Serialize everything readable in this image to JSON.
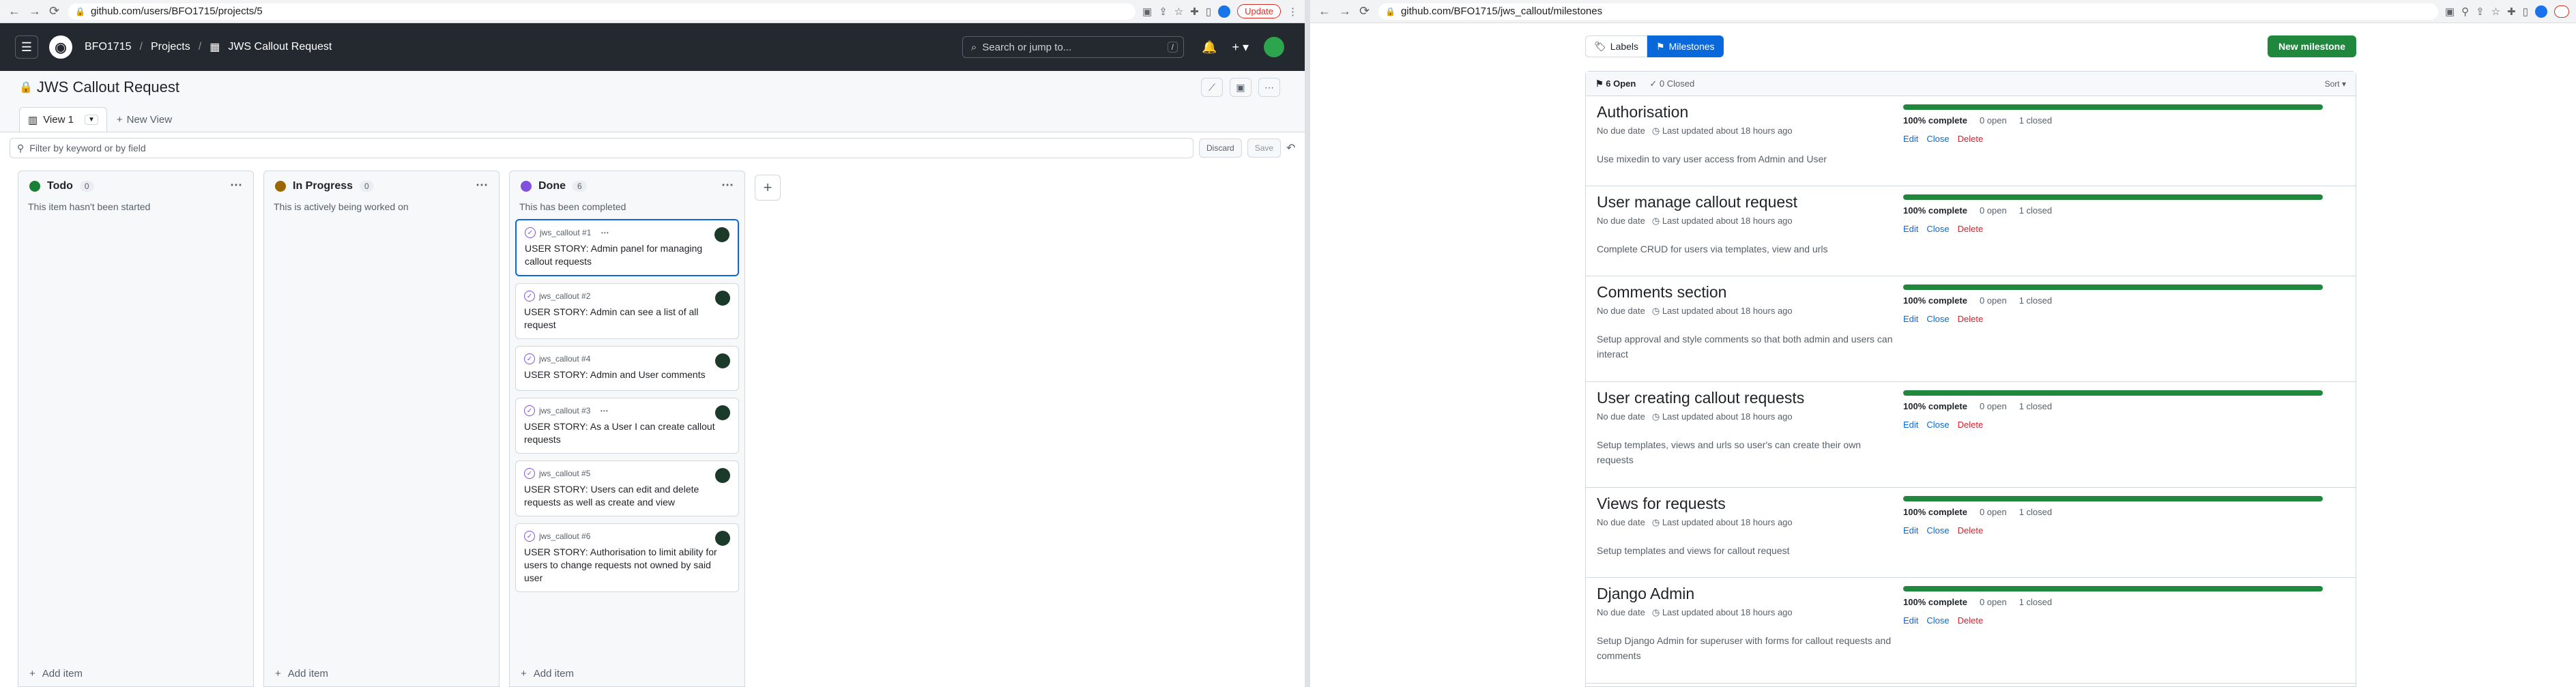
{
  "left": {
    "browser": {
      "url": "github.com/users/BFO1715/projects/5",
      "update_label": "Update"
    },
    "header": {
      "user": "BFO1715",
      "projects": "Projects",
      "project_name": "JWS Callout Request",
      "search_placeholder": "Search or jump to..."
    },
    "project_title": "JWS Callout Request",
    "views": {
      "active": "View 1",
      "new_view": "New View"
    },
    "filter": {
      "placeholder": "Filter by keyword or by field",
      "discard": "Discard",
      "save": "Save"
    },
    "columns": [
      {
        "name": "Todo",
        "count": "0",
        "color": "#1a7f37",
        "desc": "This item hasn't been started",
        "add": "Add item",
        "cards": []
      },
      {
        "name": "In Progress",
        "count": "0",
        "color": "#9a6700",
        "desc": "This is actively being worked on",
        "add": "Add item",
        "cards": []
      },
      {
        "name": "Done",
        "count": "6",
        "color": "#8250df",
        "desc": "This has been completed",
        "add": "Add item",
        "cards": [
          {
            "ref": "jws_callout #1",
            "title": "USER STORY: Admin panel for managing callout requests",
            "selected": true,
            "dots": true
          },
          {
            "ref": "jws_callout #2",
            "title": "USER STORY: Admin can see a list of all request",
            "selected": false,
            "dots": false
          },
          {
            "ref": "jws_callout #4",
            "title": "USER STORY: Admin and User comments",
            "selected": false,
            "dots": false
          },
          {
            "ref": "jws_callout #3",
            "title": "USER STORY: As a User I can create callout requests",
            "selected": false,
            "dots": true
          },
          {
            "ref": "jws_callout #5",
            "title": "USER STORY: Users can edit and delete requests as well as create and view",
            "selected": false,
            "dots": false
          },
          {
            "ref": "jws_callout #6",
            "title": "USER STORY: Authorisation to limit ability for users to change requests not owned by said user",
            "selected": false,
            "dots": false
          }
        ]
      }
    ]
  },
  "right": {
    "browser": {
      "url": "github.com/BFO1715/jws_callout/milestones"
    },
    "tabs": {
      "labels": "Labels",
      "milestones": "Milestones"
    },
    "new_milestone": "New milestone",
    "summary": {
      "open": "6 Open",
      "closed": "0 Closed",
      "sort": "Sort"
    },
    "milestones": [
      {
        "title": "Authorisation",
        "due": "No due date",
        "updated": "Last updated about 18 hours ago",
        "desc": "Use mixedin to vary user access from Admin and User",
        "progress": 1.0,
        "complete": "100% complete",
        "open": "0 open",
        "closed": "1 closed",
        "tall": false
      },
      {
        "title": "User manage callout request",
        "due": "No due date",
        "updated": "Last updated about 18 hours ago",
        "desc": "Complete CRUD for users via templates, view and urls",
        "progress": 1.0,
        "complete": "100% complete",
        "open": "0 open",
        "closed": "1 closed",
        "tall": false
      },
      {
        "title": "Comments section",
        "due": "No due date",
        "updated": "Last updated about 18 hours ago",
        "desc": "Setup approval and style comments so that both admin and users can interact",
        "progress": 1.0,
        "complete": "100% complete",
        "open": "0 open",
        "closed": "1 closed",
        "tall": true
      },
      {
        "title": "User creating callout requests",
        "due": "No due date",
        "updated": "Last updated about 18 hours ago",
        "desc": "Setup templates, views and urls so user's can create their own requests",
        "progress": 1.0,
        "complete": "100% complete",
        "open": "0 open",
        "closed": "1 closed",
        "tall": true
      },
      {
        "title": "Views for requests",
        "due": "No due date",
        "updated": "Last updated about 18 hours ago",
        "desc": "Setup templates and views for callout request",
        "progress": 1.0,
        "complete": "100% complete",
        "open": "0 open",
        "closed": "1 closed",
        "tall": false
      },
      {
        "title": "Django Admin",
        "due": "No due date",
        "updated": "Last updated about 18 hours ago",
        "desc": "Setup Django Admin for superuser with forms for callout requests and comments",
        "progress": 1.0,
        "complete": "100% complete",
        "open": "0 open",
        "closed": "1 closed",
        "tall": true
      }
    ],
    "actions": {
      "edit": "Edit",
      "close": "Close",
      "delete": "Delete"
    }
  }
}
